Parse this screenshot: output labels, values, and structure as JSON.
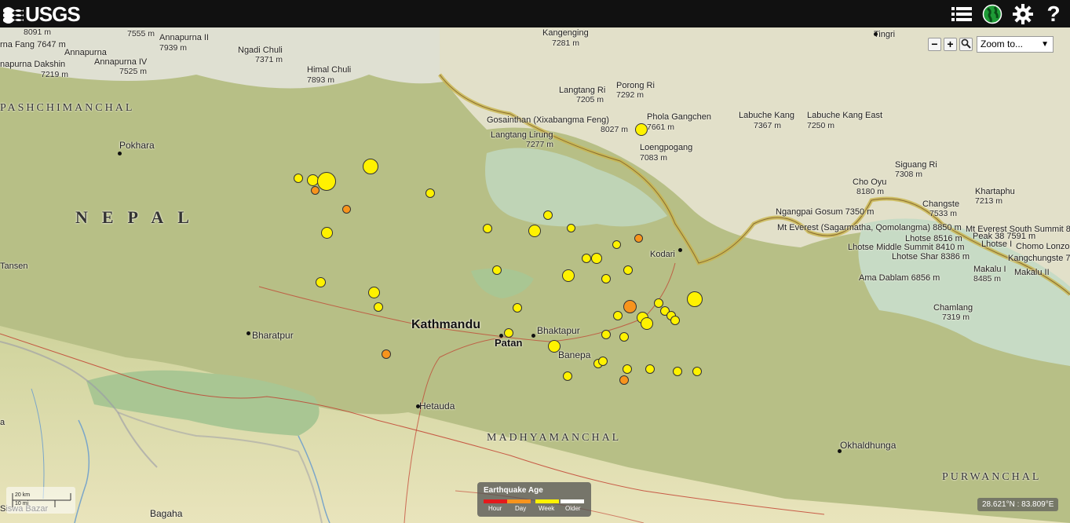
{
  "brand": {
    "name": "USGS"
  },
  "toolbar": {
    "list_icon": "list-icon",
    "globe_icon": "globe-icon",
    "settings_icon": "gear-icon",
    "help_icon": "question-icon"
  },
  "zoom": {
    "minus": "−",
    "plus": "+",
    "select_value": "Zoom to..."
  },
  "scale": {
    "km": "20 km",
    "mi": "10 mi"
  },
  "legend": {
    "title": "Earthquake Age",
    "items": [
      {
        "label": "Hour",
        "color": "#e41a1c"
      },
      {
        "label": "Day",
        "color": "#f7941d"
      },
      {
        "label": "Week",
        "color": "#fff200"
      },
      {
        "label": "Older",
        "color": "#ffffff"
      }
    ]
  },
  "coords": "28.621°N : 83.809°E",
  "labels": {
    "l0": "8091 m",
    "l1": "7555 m",
    "l2": "Annapurna II",
    "l3": "7939 m",
    "l4": "rna Fang 7647 m",
    "l5": "Annapurna",
    "l6": "Ngadi Chuli",
    "l7": "7371 m",
    "l8": "Annapurna IV",
    "l9": "napurna Dakshin",
    "l10": "7525 m",
    "l11": "7219 m",
    "l12": "Himal Chuli",
    "l13": "7893 m",
    "l14": "Kangenging",
    "l15": "7281 m",
    "l16": "Tingri",
    "l17": "Porong Ri",
    "l18": "7292 m",
    "l19": "Langtang Ri",
    "l20": "7205 m",
    "l21": "Phola Gangchen",
    "l22": "7661 m",
    "l23": "Gosainthan (Xixabangma Feng)",
    "l24": "8027 m",
    "l25": "Langtang Lirung",
    "l26": "7277 m",
    "l27": "Loengpogang",
    "l28": "7083 m",
    "l29": "Labuche Kang",
    "l30": "7367 m",
    "l31": "Labuche Kang East",
    "l32": "7250 m",
    "l33": "PASHCHIMANCHAL",
    "l34": "Pokhara",
    "l35": "Siguang Ri",
    "l36": "7308 m",
    "l37": "Cho Oyu",
    "l38": "8180 m",
    "l39": "Changste",
    "l40": "7533 m",
    "l41": "Khartaphu",
    "l42": "7213 m",
    "l43": "Ngangpai Gosum 7350 m",
    "l44": "Mt Everest (Sagarmatha, Qomolangma) 8850 m",
    "l45": "Mt Everest South Summit 87",
    "l46": "Lhotse 8516 m",
    "l47": "Peak 38 7591 m",
    "l48": "Lhotse Middle Summit 8410 m",
    "l49": "Lhotse I",
    "l50": "Chomo Lonzo",
    "l51": "Lhotse Shar 8386 m",
    "l52": "Kangchungste 7",
    "l53": "Makalu II",
    "l54": "Makalu I",
    "l55": "8485 m",
    "l56": "Ama Dablam 6856 m",
    "l57": "Chamlang",
    "l58": "7319 m",
    "l59": "NEPAL",
    "l60": "Tansen",
    "l61": "Kodari",
    "l62": "Bharatpur",
    "l63": "Kathmandu",
    "l64": "Bhaktapur",
    "l65": "Patan",
    "l66": "Banepa",
    "l67": "Hetauda",
    "l68": "MADHYAMANCHAL",
    "l69": "Okhaldhunga",
    "l70": "PURWANCHAL",
    "l71": "Siswa Bazar",
    "l72": "Bagaha",
    "l73": "a"
  },
  "earthquakes": [
    {
      "age": "week",
      "mag": "medium"
    },
    {
      "age": "week",
      "mag": "medium"
    },
    {
      "age": "week",
      "mag": "large"
    },
    {
      "age": "day",
      "mag": "small"
    },
    {
      "age": "week",
      "mag": "large"
    },
    {
      "age": "day",
      "mag": "small"
    },
    {
      "age": "week",
      "mag": "small"
    },
    {
      "age": "week",
      "mag": "medium"
    },
    {
      "age": "week",
      "mag": "medium"
    },
    {
      "age": "week",
      "mag": "small"
    },
    {
      "age": "week",
      "mag": "medium"
    },
    {
      "age": "week",
      "mag": "small"
    },
    {
      "age": "week",
      "mag": "small"
    },
    {
      "age": "week",
      "mag": "medium"
    },
    {
      "age": "week",
      "mag": "small"
    },
    {
      "age": "day",
      "mag": "small"
    },
    {
      "age": "week",
      "mag": "small"
    },
    {
      "age": "week",
      "mag": "small"
    },
    {
      "age": "week",
      "mag": "medium"
    },
    {
      "age": "week",
      "mag": "small"
    },
    {
      "age": "week",
      "mag": "small"
    },
    {
      "age": "week",
      "mag": "medium"
    },
    {
      "age": "week",
      "mag": "small"
    },
    {
      "age": "week",
      "mag": "small"
    },
    {
      "age": "week",
      "mag": "small"
    },
    {
      "age": "day",
      "mag": "medium"
    },
    {
      "age": "week",
      "mag": "small"
    },
    {
      "age": "week",
      "mag": "small"
    },
    {
      "age": "week",
      "mag": "large"
    },
    {
      "age": "week",
      "mag": "small"
    },
    {
      "age": "week",
      "mag": "small"
    },
    {
      "age": "week",
      "mag": "small"
    },
    {
      "age": "week",
      "mag": "small"
    },
    {
      "age": "week",
      "mag": "small"
    },
    {
      "age": "week",
      "mag": "medium"
    },
    {
      "age": "week",
      "mag": "medium"
    },
    {
      "age": "week",
      "mag": "small"
    },
    {
      "age": "week",
      "mag": "small"
    },
    {
      "age": "week",
      "mag": "small"
    },
    {
      "age": "week",
      "mag": "small"
    },
    {
      "age": "day",
      "mag": "small"
    },
    {
      "age": "week",
      "mag": "small"
    },
    {
      "age": "day",
      "mag": "small"
    },
    {
      "age": "week",
      "mag": "small"
    },
    {
      "age": "week",
      "mag": "small"
    },
    {
      "age": "week",
      "mag": "small"
    },
    {
      "age": "week",
      "mag": "medium"
    }
  ]
}
